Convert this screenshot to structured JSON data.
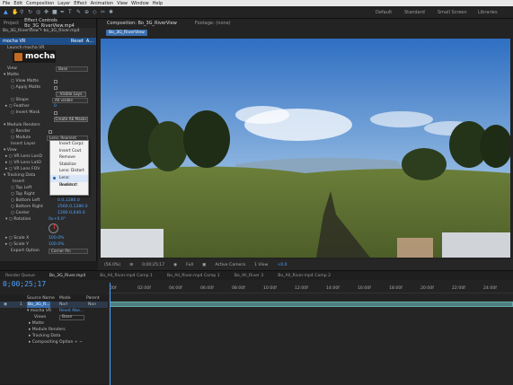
{
  "menu": [
    "File",
    "Edit",
    "Composition",
    "Layer",
    "Effect",
    "Animation",
    "View",
    "Window",
    "Help"
  ],
  "workspaces": [
    "Default",
    "Standard",
    "Small Screen",
    "Libraries"
  ],
  "left_panel": {
    "tab_project": "Project",
    "tab_effects": "Effect Controls Bo_3G_RiverView.mp4",
    "breadcrumb": "Bo_3G_RiverView • bo_3G_River.mp4",
    "effect_name": "mocha VR",
    "reset_label": "Reset",
    "about_label": "A...",
    "launch_label": "Launch mocha VR",
    "mocha_logo_text": "mocha",
    "view_label": "View",
    "view_value": "Base",
    "matte_section": "Matte",
    "view_matte": "View Matte",
    "apply_matte": "Apply Matte",
    "visible_layers_btn": "Visible Lays",
    "shape_label": "Shape",
    "shape_value": "All visible",
    "feather_label": "Feather",
    "feather_value": "0",
    "invert_mask": "Invert Mask",
    "create_ae_masks": "Create AE Masks",
    "module_renders_section": "Module Renders",
    "render_label": "Render",
    "module_label": "Module",
    "module_value": "Lens: Reorient",
    "insert_layer_label": "Insert Layer",
    "view_section": "View",
    "vr_lens_lon": "VR Lens LonD",
    "vr_lens_lat": "VR Lens LatD",
    "vr_lens_fov": "VR Lens FOV",
    "tracking_section": "Tracking Data",
    "insert_label": "Insert",
    "top_left": "Top Left",
    "top_left_val": "0.0,0.0",
    "top_right": "Top Right",
    "top_right_val": "2560.0,0.0",
    "bottom_left": "Bottom Left",
    "bottom_left_val": "0.0,1280.0",
    "bottom_right": "Bottom Right",
    "bottom_right_val": "2560.0,1280.0",
    "center": "Center",
    "center_val": "1280.0,640.0",
    "rotation": "Rotation",
    "rotation_val": "0x+0.0°",
    "scale_x": "Scale X",
    "scale_x_val": "100.0%",
    "scale_y": "Scale Y",
    "scale_y_val": "100.0%",
    "export_option": "Export Option",
    "export_value": "Corner Pin"
  },
  "dropdown": {
    "items": [
      "Insert Corpz",
      "Insert Cout",
      "Remove",
      "Stabilize",
      "Lens: Distort",
      "Lens: Undistort",
      "Reorient"
    ],
    "selected_index": 5
  },
  "comp": {
    "tab_comp": "Composition: Bo_3G_RiverView",
    "tab_footage": "Footage: (none)",
    "crumb": "Bo_3G_RiverView",
    "zoom": "(56.0%)",
    "timecode": "0;00;25;17",
    "resolution": "Full",
    "camera": "Active Camera",
    "views": "1 View",
    "exposure": "+0.0"
  },
  "timeline": {
    "tabs": [
      "Render Queue",
      "Bo_3G_River.mp4",
      "Bo_All_River.mp4 Comp 1",
      "Bo_All_River.mp4 Comp 1",
      "Bo_All_River 3",
      "Bo_All_River.mp4 Comp 2"
    ],
    "timecode": "0;00;25;17",
    "ticks": [
      "00f",
      "02:00f",
      "04:00f",
      "06:00f",
      "08:00f",
      "10:00f",
      "12:00f",
      "14:00f",
      "16:00f",
      "18:00f",
      "20:00f",
      "22:00f",
      "24:00f"
    ],
    "col_source": "Source Name",
    "col_mode": "Mode",
    "col_parent": "Parent",
    "layer_num": "1",
    "layer_name": "Bo_3G_R...",
    "layer_mode": "Norl",
    "layer_parent": "Non",
    "effect_row": "mocha VR",
    "reset_row": "Reset",
    "about_row": "Abo...",
    "views_row": "Views",
    "views_val": "Base",
    "matte_row": "Matte",
    "module_renders_row": "Module Renders",
    "tracking_row": "Tracking Data",
    "compositing_row": "Compositing Option"
  }
}
